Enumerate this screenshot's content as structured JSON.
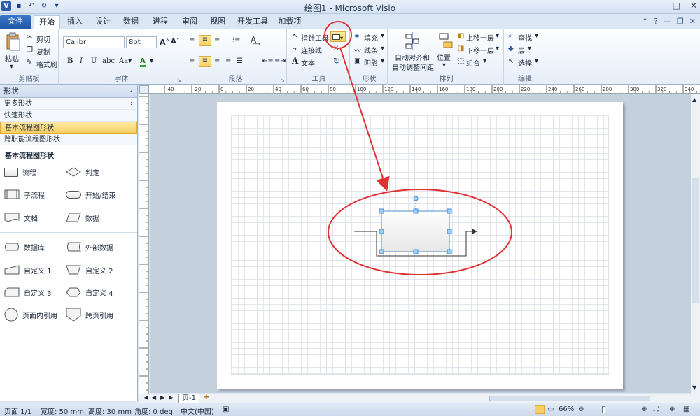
{
  "window": {
    "title": "绘图1 - Microsoft Visio"
  },
  "tabs": [
    {
      "label": "文件"
    },
    {
      "label": "开始"
    },
    {
      "label": "插入"
    },
    {
      "label": "设计"
    },
    {
      "label": "数据"
    },
    {
      "label": "进程"
    },
    {
      "label": "审阅"
    },
    {
      "label": "视图"
    },
    {
      "label": "开发工具"
    },
    {
      "label": "加载项"
    }
  ],
  "ribbon": {
    "clipboard": {
      "paste": "粘贴",
      "cut": "剪切",
      "copy": "复制",
      "format_painter": "格式刷",
      "label": "剪贴板"
    },
    "font": {
      "family": "Calibri",
      "size": "8pt",
      "label": "字体"
    },
    "paragraph": {
      "label": "段落"
    },
    "tools": {
      "pointer": "指针工具",
      "connector": "连接线",
      "text": "文本",
      "label": "工具"
    },
    "shape": {
      "fill": "填充",
      "line": "线条",
      "shadow": "阴影",
      "label": "形状"
    },
    "arrange": {
      "auto_align_1": "自动对齐和",
      "auto_align_2": "自动调整间距",
      "position": "位置",
      "bring_forward": "上移一层",
      "send_backward": "下移一层",
      "group": "组合",
      "label": "排列"
    },
    "editing": {
      "find": "查找",
      "layers": "层",
      "select": "选择",
      "label": "编辑"
    }
  },
  "shapes_pane": {
    "title": "形状",
    "more_shapes": "更多形状",
    "quick_shapes": "快速形状",
    "basic_flowchart": "基本流程图形状",
    "cross_functional": "跨职能流程图形状",
    "stencil_title": "基本流程图形状",
    "items": [
      {
        "label": "流程"
      },
      {
        "label": "判定"
      },
      {
        "label": "子流程"
      },
      {
        "label": "开始/结束"
      },
      {
        "label": "文档"
      },
      {
        "label": "数据"
      },
      {
        "label": "数据库"
      },
      {
        "label": "外部数据"
      },
      {
        "label": "自定义 1"
      },
      {
        "label": "自定义 2"
      },
      {
        "label": "自定义 3"
      },
      {
        "label": "自定义 4"
      },
      {
        "label": "页面内引用"
      },
      {
        "label": "跨页引用"
      }
    ]
  },
  "ruler": {
    "top_ticks": [
      "-40",
      "-20",
      "0",
      "20",
      "40",
      "60",
      "80",
      "100",
      "120",
      "140",
      "160",
      "180",
      "200",
      "220",
      "240",
      "260",
      "280",
      "300",
      "320",
      "340"
    ]
  },
  "page_tab": "页-1",
  "status": {
    "page": "页面 1/1",
    "width": "宽度: 50 mm",
    "height": "高度: 30 mm",
    "angle": "角度: 0 deg",
    "lang": "中文(中国)",
    "zoom": "66%"
  },
  "colors": {
    "annotation": "#e03232",
    "selection": "#3a8ee6",
    "ribbon_highlight": "#f8cf63"
  }
}
